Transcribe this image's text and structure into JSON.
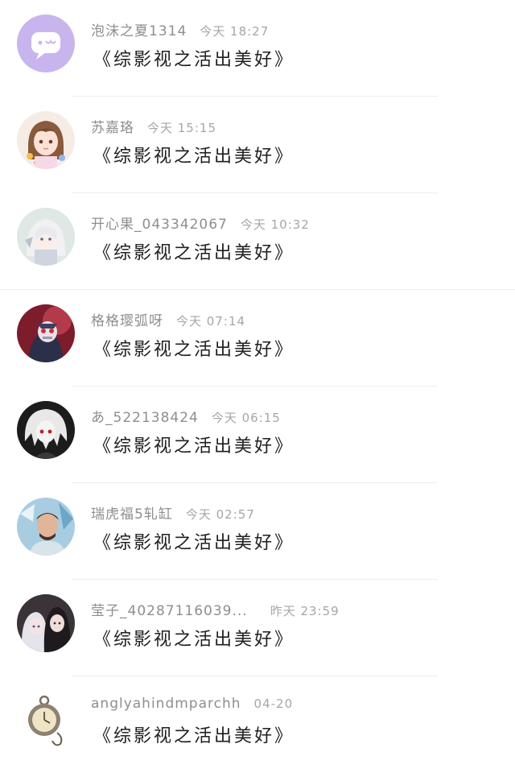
{
  "messages": [
    {
      "name": "泡沫之夏1314",
      "time": "今天 18:27",
      "text": "《综影视之活出美好》",
      "avatar": "chat-bubble-icon",
      "avatar_color": "#c9b6ee"
    },
    {
      "name": "苏嘉珞",
      "time": "今天 15:15",
      "text": "《综影视之活出美好》",
      "avatar": "anime-girl-avatar",
      "avatar_color": "#f3e6e0"
    },
    {
      "name": "开心果_043342067",
      "time": "今天 10:32",
      "text": "《综影视之活出美好》",
      "avatar": "white-hair-anime-avatar",
      "avatar_color": "#e6ece8"
    },
    {
      "name": "格格璎弧呀",
      "time": "今天 07:14",
      "text": "《综影视之活出美好》",
      "avatar": "masked-figure-avatar",
      "avatar_color": "#8a1f2c"
    },
    {
      "name": "あ_522138424",
      "time": "今天 06:15",
      "text": "《综影视之活出美好》",
      "avatar": "monochrome-anime-avatar",
      "avatar_color": "#222222"
    },
    {
      "name": "瑞虎福5轧缸",
      "time": "今天 02:57",
      "text": "《综影视之活出美好》",
      "avatar": "man-portrait-avatar",
      "avatar_color": "#a9c8d8"
    },
    {
      "name": "莹子_40287116039...",
      "time": "昨天 23:59",
      "text": "《综影视之活出美好》",
      "avatar": "two-girls-avatar",
      "avatar_color": "#3a3438"
    },
    {
      "name": "anglyahindmparchh",
      "time": "04-20",
      "text": "《综影视之活出美好》",
      "avatar": "pocket-watch-avatar",
      "avatar_color": "#f5f2ec"
    }
  ]
}
